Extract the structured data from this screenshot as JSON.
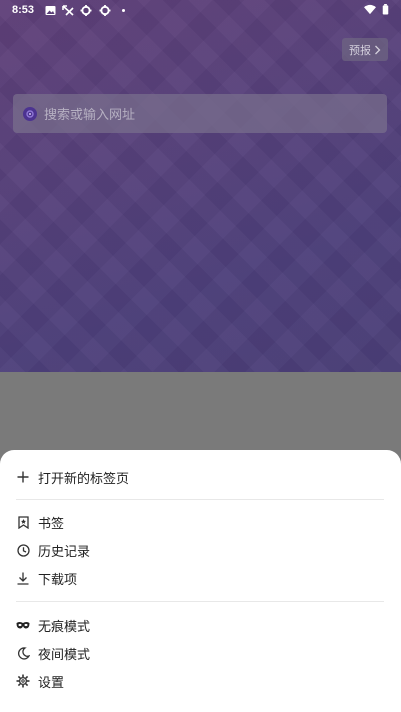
{
  "status_bar": {
    "time": "8:53"
  },
  "header": {
    "report_label": "预报"
  },
  "search": {
    "placeholder": "搜索或输入网址"
  },
  "menu": {
    "group1": [
      {
        "label": "打开新的标签页",
        "icon": "plus-icon"
      }
    ],
    "group2": [
      {
        "label": "书签",
        "icon": "bookmark-icon"
      },
      {
        "label": "历史记录",
        "icon": "clock-icon"
      },
      {
        "label": "下载项",
        "icon": "download-icon"
      }
    ],
    "group3": [
      {
        "label": "无痕模式",
        "icon": "incognito-mask-icon"
      },
      {
        "label": "夜间模式",
        "icon": "moon-icon"
      },
      {
        "label": "设置",
        "icon": "gear-icon"
      }
    ]
  },
  "colors": {
    "hero_purple": "#57407a",
    "scrim_gray": "#7a7a7a",
    "sheet_bg": "#ffffff",
    "text_primary": "#222222"
  }
}
